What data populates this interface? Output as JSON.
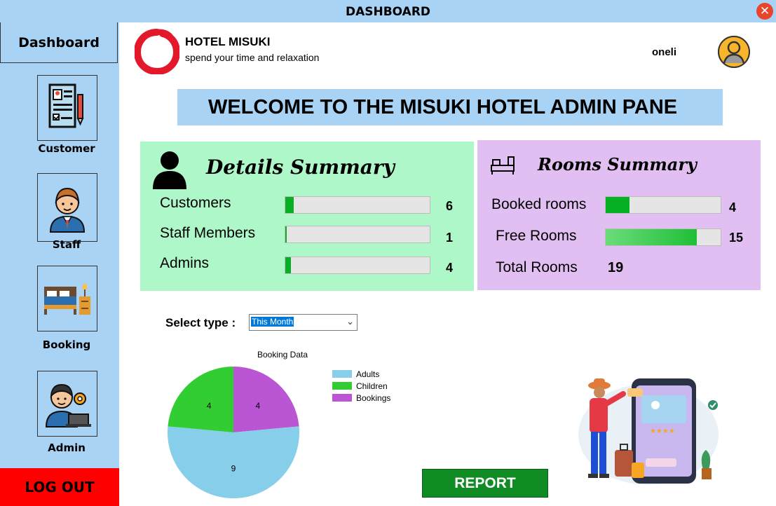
{
  "window": {
    "title": "DASHBOARD",
    "close_icon": "close-icon"
  },
  "sidebar": {
    "dashboard_label": "Dashboard",
    "items": [
      {
        "label": "Customer",
        "icon": "customer-form-icon"
      },
      {
        "label": "Staff",
        "icon": "staff-icon"
      },
      {
        "label": "Booking",
        "icon": "bed-icon"
      },
      {
        "label": "Admin",
        "icon": "admin-icon"
      }
    ],
    "logout_label": "LOG OUT"
  },
  "header": {
    "hotel_name": "HOTEL MISUKI",
    "tagline": "spend your time and relaxation",
    "username": "oneli"
  },
  "welcome": "WELCOME TO THE MISUKI HOTEL ADMIN PANE",
  "details_summary": {
    "title": "Details Summary",
    "rows": [
      {
        "label": "Customers",
        "value": "6",
        "fill": 0.06
      },
      {
        "label": "Staff Members",
        "value": "1",
        "fill": 0.01
      },
      {
        "label": "Admins",
        "value": "4",
        "fill": 0.04
      }
    ]
  },
  "rooms_summary": {
    "title": "Rooms Summary",
    "booked": {
      "label": "Booked rooms",
      "value": "4",
      "fill": 0.21
    },
    "free": {
      "label": "Free Rooms",
      "value": "15",
      "fill": 0.79
    },
    "total": {
      "label": "Total Rooms",
      "value": "19"
    }
  },
  "select_type": {
    "label": "Select type :",
    "value": "This Month"
  },
  "chart_data": {
    "type": "pie",
    "title": "Booking Data",
    "categories": [
      "Adults",
      "Children",
      "Bookings"
    ],
    "values": [
      9,
      4,
      4
    ],
    "colors": [
      "#87ceeb",
      "#32cd32",
      "#ba55d3"
    ],
    "legend": "right"
  },
  "report_label": "REPORT"
}
